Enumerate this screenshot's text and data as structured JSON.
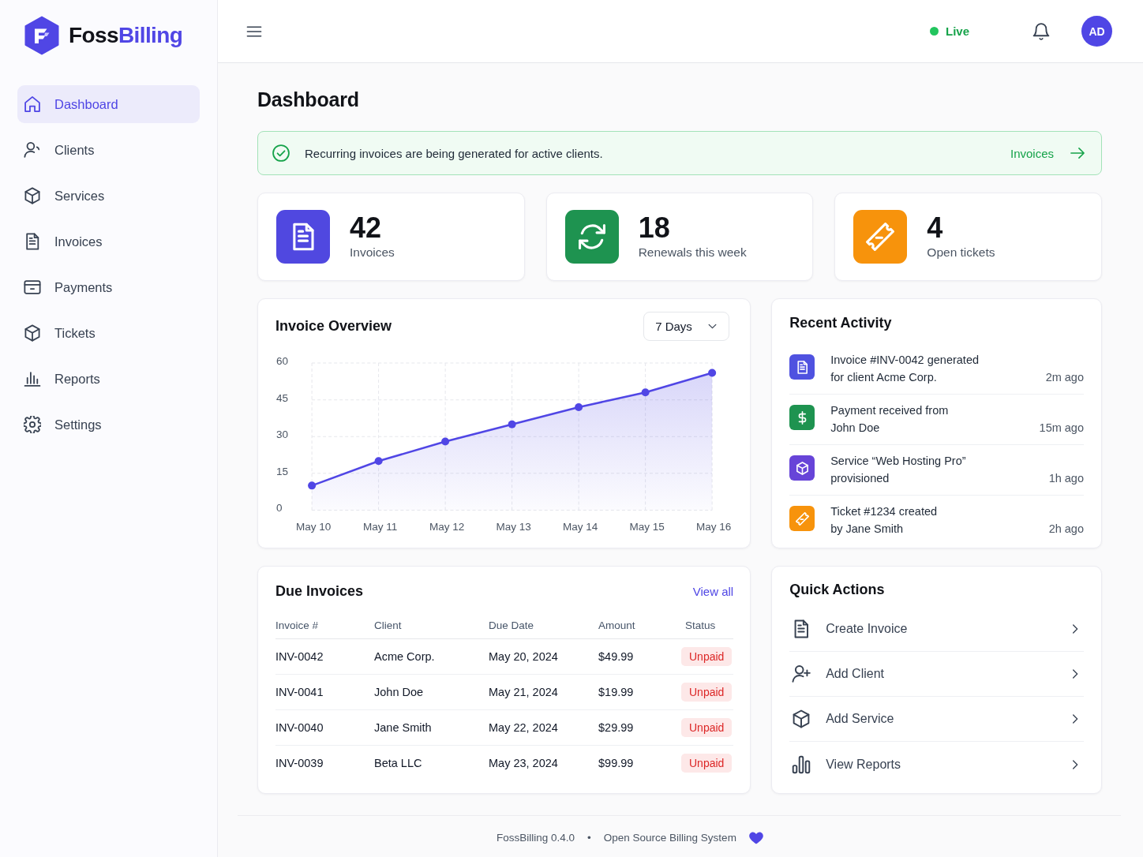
{
  "sidebar": {
    "brand": {
      "name_start": "Foss",
      "name_end": "Billing"
    },
    "items": [
      {
        "label": "Dashboard",
        "selected": true
      },
      {
        "label": "Clients",
        "selected": false
      },
      {
        "label": "Services",
        "selected": false
      },
      {
        "label": "Invoices",
        "selected": false
      },
      {
        "label": "Payments",
        "selected": false
      },
      {
        "label": "Tickets",
        "selected": false
      },
      {
        "label": "Reports",
        "selected": false
      },
      {
        "label": "Settings",
        "selected": false
      }
    ]
  },
  "topbar": {
    "status": "Live",
    "avatar": "AD"
  },
  "page_title": "Dashboard",
  "alert": {
    "message": "Recurring invoices are being generated for active clients.",
    "link": "Invoices"
  },
  "stats": [
    {
      "value": "42",
      "label": "Invoices",
      "color": "#5048e0"
    },
    {
      "value": "18",
      "label": "Renewals this week",
      "color": "#1e9350"
    },
    {
      "value": "4",
      "label": "Open tickets",
      "color": "#f7930c"
    }
  ],
  "invoice_overview": {
    "title": "Invoice Overview",
    "range": "7 Days",
    "chart_data": {
      "type": "area",
      "categories": [
        "May 10",
        "May 11",
        "May 12",
        "May 13",
        "May 14",
        "May 15",
        "May 16"
      ],
      "series": [
        {
          "color": "#5046e5",
          "values": [
            10,
            20,
            28,
            35,
            42,
            48,
            56
          ]
        }
      ],
      "ylim": [
        0,
        60
      ],
      "yticks": [
        0,
        15,
        30,
        45,
        60
      ],
      "grid": true
    }
  },
  "recent_activity": {
    "title": "Recent Activity",
    "items": [
      {
        "text": "Invoice #INV-0042 generated\nfor client Acme Corp.",
        "time": "2m ago",
        "color": "#4f52e0"
      },
      {
        "text": "Payment received from\nJohn Doe",
        "time": "15m ago",
        "color": "#1e9350"
      },
      {
        "text": "Service “Web Hosting Pro”\nprovisioned",
        "time": "1h ago",
        "color": "#6744d8"
      },
      {
        "text": "Ticket #1234 created\nby Jane Smith",
        "time": "2h ago",
        "color": "#f7930c"
      }
    ]
  },
  "due_invoices": {
    "title": "Due Invoices",
    "link": "View all",
    "columns": [
      "Invoice #",
      "Client",
      "Due Date",
      "Amount",
      "Status"
    ],
    "rows": [
      {
        "invoice": "INV-0042",
        "client": "Acme Corp.",
        "due_date": "May 20, 2024",
        "amount": "$49.99",
        "status": "Unpaid"
      },
      {
        "invoice": "INV-0041",
        "client": "John Doe",
        "due_date": "May 21, 2024",
        "amount": "$19.99",
        "status": "Unpaid"
      },
      {
        "invoice": "INV-0040",
        "client": "Jane Smith",
        "due_date": "May 22, 2024",
        "amount": "$29.99",
        "status": "Unpaid"
      },
      {
        "invoice": "INV-0039",
        "client": "Beta LLC",
        "due_date": "May 23, 2024",
        "amount": "$99.99",
        "status": "Unpaid"
      }
    ]
  },
  "quick_actions": {
    "title": "Quick Actions",
    "items": [
      {
        "label": "Create Invoice"
      },
      {
        "label": "Add Client"
      },
      {
        "label": "Add Service"
      },
      {
        "label": "View Reports"
      }
    ]
  },
  "footer": {
    "version": "FossBilling 0.4.0",
    "separator": "•",
    "tagline": "Open Source Billing System"
  }
}
